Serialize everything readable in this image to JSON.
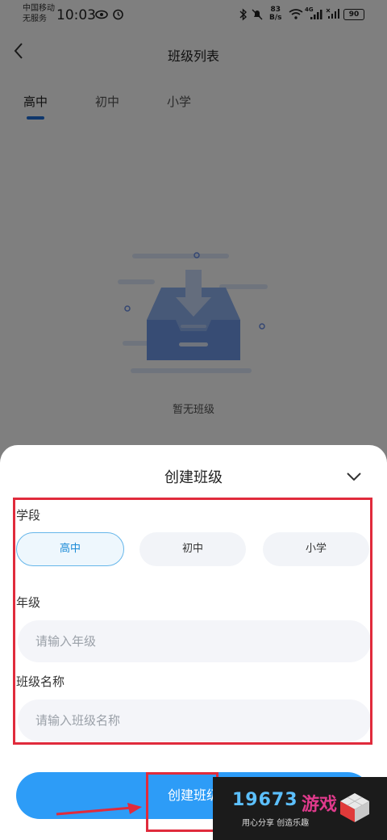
{
  "status_bar": {
    "carrier_line1": "中国移动",
    "carrier_line2": "无服务",
    "time": "10:03",
    "net_speed_value": "83",
    "net_speed_unit": "B/s",
    "signal_label": "4G",
    "battery": "90"
  },
  "header": {
    "title": "班级列表"
  },
  "tabs": [
    {
      "label": "高中",
      "active": true
    },
    {
      "label": "初中",
      "active": false
    },
    {
      "label": "小学",
      "active": false
    }
  ],
  "empty_state": {
    "text": "暂无班级"
  },
  "sheet": {
    "title": "创建班级",
    "stage_label": "学段",
    "stage_options": [
      "高中",
      "初中",
      "小学"
    ],
    "stage_selected": "高中",
    "grade_label": "年级",
    "grade_placeholder": "请输入年级",
    "class_name_label": "班级名称",
    "class_name_placeholder": "请输入班级名称",
    "submit_label": "创建班级"
  },
  "watermark": {
    "number": "19673",
    "brand": "游戏",
    "slogan": "用心分享  创造乐趣"
  },
  "colors": {
    "accent": "#2d9cf7",
    "tab_indicator": "#1e6fd9",
    "annotation_red": "#e02b3c"
  }
}
